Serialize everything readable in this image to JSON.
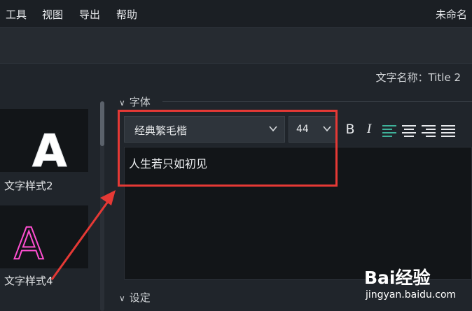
{
  "menu": {
    "items": [
      "工具",
      "视图",
      "导出",
      "帮助"
    ],
    "window_title": "未命名"
  },
  "text_name": {
    "label": "文字名称：Title 2"
  },
  "styles": {
    "items": [
      {
        "glyph": "A",
        "label": "文字样式2"
      },
      {
        "glyph": "A",
        "label": "文字样式4"
      }
    ]
  },
  "font_section": {
    "header": "字体",
    "font_family": "经典繁毛楷",
    "font_size": "44",
    "bold_label": "B",
    "italic_label": "I",
    "text_content": "人生若只如初见"
  },
  "settings_section": {
    "header": "设定"
  },
  "watermark": {
    "brand": "Bai经验",
    "url": "jingyan.baidu.com"
  },
  "colors": {
    "highlight": "#e53935",
    "accent_align": "#3fb29a"
  }
}
